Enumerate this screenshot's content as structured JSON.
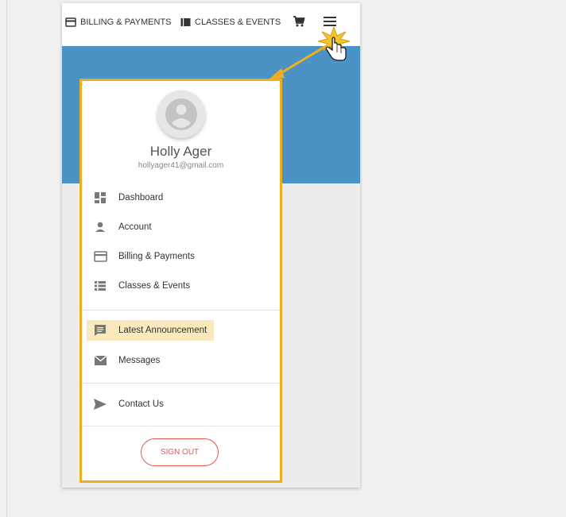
{
  "nav": {
    "billing_label": "BILLING & PAYMENTS",
    "classes_label": "CLASSES & EVENTS",
    "cart_icon": "cart-icon",
    "menu_icon": "hamburger-menu-icon"
  },
  "user": {
    "name": "Holly Ager",
    "email": "hollyager41@gmail.com"
  },
  "menu": {
    "items": [
      {
        "label": "Dashboard",
        "icon": "dashboard-icon"
      },
      {
        "label": "Account",
        "icon": "person-icon"
      },
      {
        "label": "Billing & Payments",
        "icon": "credit-card-icon"
      },
      {
        "label": "Classes & Events",
        "icon": "list-icon"
      },
      {
        "label": "Latest Announcement",
        "icon": "announcement-icon",
        "highlighted": true
      },
      {
        "label": "Messages",
        "icon": "mail-icon"
      },
      {
        "label": "Contact Us",
        "icon": "send-icon"
      }
    ],
    "signout_label": "SIGN OUT"
  },
  "colors": {
    "highlight_border": "#f0ae1f",
    "header_blue": "#4a93c4",
    "signout_red": "#e05a4e",
    "item_highlight": "#fae9bd"
  }
}
